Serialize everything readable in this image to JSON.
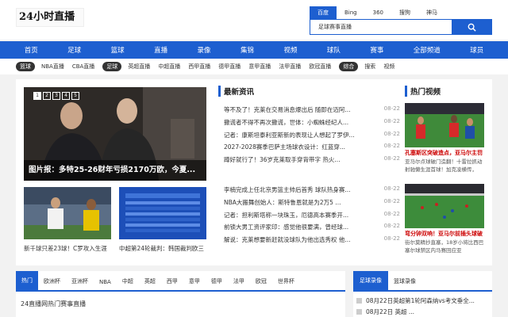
{
  "logo": "24小时直播",
  "search": {
    "engines": [
      "百度",
      "Bing",
      "360",
      "搜狗",
      "神马"
    ],
    "active_engine": 0,
    "value": "足球赛事直播"
  },
  "nav": [
    "首页",
    "足球",
    "篮球",
    "直播",
    "录像",
    "集锦",
    "视频",
    "球队",
    "赛事",
    "全部频道",
    "球员"
  ],
  "subnav": [
    {
      "label": "篮球",
      "tag": true
    },
    {
      "label": "NBA直播",
      "tag": false
    },
    {
      "label": "CBA直播",
      "tag": false
    },
    {
      "label": "足球",
      "tag": true
    },
    {
      "label": "英超直播",
      "tag": false
    },
    {
      "label": "中超直播",
      "tag": false
    },
    {
      "label": "西甲直播",
      "tag": false
    },
    {
      "label": "德甲直播",
      "tag": false
    },
    {
      "label": "意甲直播",
      "tag": false
    },
    {
      "label": "法甲直播",
      "tag": false
    },
    {
      "label": "欧冠直播",
      "tag": false
    },
    {
      "label": "综合",
      "tag": true
    },
    {
      "label": "搜索",
      "tag": false
    },
    {
      "label": "视频",
      "tag": false
    }
  ],
  "banner": {
    "pages": [
      "1",
      "2",
      "3",
      "4",
      "5"
    ],
    "active_page": 0,
    "caption": "图片报：多特25-26财年亏损2170万欧，今夏..."
  },
  "thumbs": [
    {
      "caption": "新千球只差23球！C罗攻入生涯"
    },
    {
      "caption": "中超第24轮裁判：韩国裁判欧三"
    }
  ],
  "news": {
    "title": "最新资讯",
    "group1": [
      {
        "t": "等不及了！克莱在交易消息爆出后 随即在迈阿...",
        "d": "08-22"
      },
      {
        "t": "撒谎者不得不再次撒谎，世体：小蜘蛛经纪人...",
        "d": "08-22"
      },
      {
        "t": "记者：康斯坦泰利亚斯新的表现让人想起了罗伊...",
        "d": "08-22"
      },
      {
        "t": "2027-2028赛季巴萨主场球衣设计：红蓝穿...",
        "d": "08-22"
      },
      {
        "t": "蹲好就行了！36岁克莱取手穿背带字 热火...",
        "d": "08-22"
      }
    ],
    "group2": [
      {
        "t": "李楠完成上任北京男篮主帅后首秀 球队热身赛...",
        "d": "08-22"
      },
      {
        "t": "NBA大搬舞创始人：斯特鲁恩就是为2万5 ...",
        "d": "08-22"
      },
      {
        "t": "记者：担利斯塔称一块珠玉，厄德高本赛季开...",
        "d": "08-22"
      },
      {
        "t": "前锁大男工资评家印：感觉他很要满，曾经球...",
        "d": "08-22"
      },
      {
        "t": "解说：克莱想要新赶就没球队为他出选秀权 他...",
        "d": "08-22"
      }
    ]
  },
  "hot": {
    "title": "热门视频",
    "items": [
      {
        "title": "孔塞斯区突破造点，亚马尔主罚",
        "desc": "亚马尔点球破门造翻！十雷拉抓动射驰懒生涯首球！加克凌横传，"
      },
      {
        "title": "弯分钟双响！亚马尔前插头球破",
        "desc": "街尔莫精抄直塞，18岁小将比西巴塞尔球禁区内马赛回应亚"
      }
    ]
  },
  "bottom_tabs": [
    "热门",
    "欧洲杯",
    "亚洲杯",
    "NBA",
    "中超",
    "英超",
    "西甲",
    "意甲",
    "德甲",
    "法甲",
    "欧冠",
    "世界杯"
  ],
  "bottom_text": "24直播网热门赛事直播",
  "side_tabs": [
    "足球录像",
    "篮球录像"
  ],
  "side_list": [
    "08月22日英超第1轮阿森纳vs考文垂全...",
    "08月22日 英超 ..."
  ],
  "colors": {
    "accent": "#1d5fd0",
    "hot_title": "#cc0000"
  }
}
